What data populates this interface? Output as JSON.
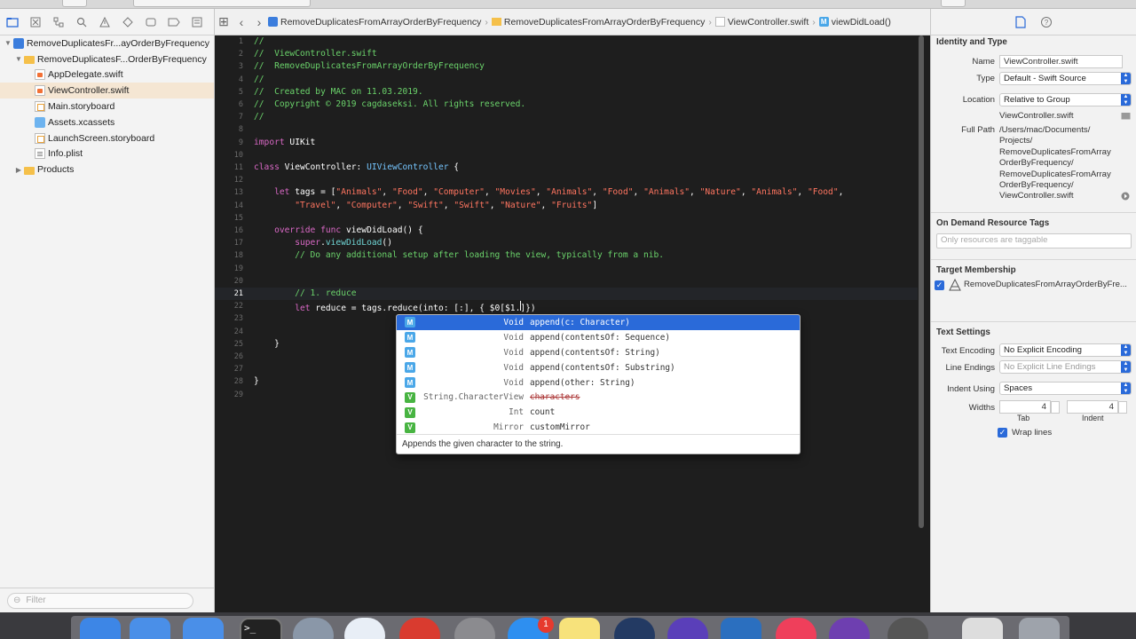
{
  "navigator": {
    "items": [
      {
        "label": "RemoveDuplicatesFr...ayOrderByFrequency",
        "kind": "project",
        "indent": 0,
        "disclosure": "▼"
      },
      {
        "label": "RemoveDuplicatesF...OrderByFrequency",
        "kind": "folder",
        "indent": 1,
        "disclosure": "▼"
      },
      {
        "label": "AppDelegate.swift",
        "kind": "swift",
        "indent": 2,
        "disclosure": ""
      },
      {
        "label": "ViewController.swift",
        "kind": "swift",
        "indent": 2,
        "disclosure": "",
        "selected": true
      },
      {
        "label": "Main.storyboard",
        "kind": "storyboard",
        "indent": 2,
        "disclosure": ""
      },
      {
        "label": "Assets.xcassets",
        "kind": "assets",
        "indent": 2,
        "disclosure": ""
      },
      {
        "label": "LaunchScreen.storyboard",
        "kind": "storyboard",
        "indent": 2,
        "disclosure": ""
      },
      {
        "label": "Info.plist",
        "kind": "plist",
        "indent": 2,
        "disclosure": ""
      },
      {
        "label": "Products",
        "kind": "folder",
        "indent": 1,
        "disclosure": "▶"
      }
    ],
    "filter_placeholder": "Filter"
  },
  "jumpbar": {
    "crumbs": [
      "RemoveDuplicatesFromArrayOrderByFrequency",
      "RemoveDuplicatesFromArrayOrderByFrequency",
      "ViewController.swift",
      "viewDidLoad()"
    ]
  },
  "editor": {
    "current_line": 21,
    "line_numbers": [
      "1",
      "2",
      "3",
      "4",
      "5",
      "6",
      "7",
      "8",
      "9",
      "10",
      "11",
      "12",
      "13",
      "14",
      "15",
      "16",
      "17",
      "18",
      "19",
      "20",
      "21",
      "22",
      "23",
      "24",
      "25",
      "26",
      "27",
      "28",
      "29"
    ],
    "lines": [
      [
        {
          "t": "//",
          "c": "com"
        }
      ],
      [
        {
          "t": "//  ViewController.swift",
          "c": "com"
        }
      ],
      [
        {
          "t": "//  RemoveDuplicatesFromArrayOrderByFrequency",
          "c": "com"
        }
      ],
      [
        {
          "t": "//",
          "c": "com"
        }
      ],
      [
        {
          "t": "//  Created by MAC on 11.03.2019.",
          "c": "com"
        }
      ],
      [
        {
          "t": "//  Copyright © 2019 cagdaseksi. All rights reserved.",
          "c": "com"
        }
      ],
      [
        {
          "t": "//",
          "c": "com"
        }
      ],
      [],
      [
        {
          "t": "import",
          "c": "kw"
        },
        {
          "t": " UIKit",
          "c": ""
        }
      ],
      [],
      [
        {
          "t": "class",
          "c": "kw"
        },
        {
          "t": " ViewController: ",
          "c": ""
        },
        {
          "t": "UIViewController",
          "c": "typ"
        },
        {
          "t": " {",
          "c": ""
        }
      ],
      [],
      [
        {
          "t": "    let",
          "c": "kw"
        },
        {
          "t": " tags = [",
          "c": ""
        },
        {
          "t": "\"Animals\"",
          "c": "str"
        },
        {
          "t": ", ",
          "c": ""
        },
        {
          "t": "\"Food\"",
          "c": "str"
        },
        {
          "t": ", ",
          "c": ""
        },
        {
          "t": "\"Computer\"",
          "c": "str"
        },
        {
          "t": ", ",
          "c": ""
        },
        {
          "t": "\"Movies\"",
          "c": "str"
        },
        {
          "t": ", ",
          "c": ""
        },
        {
          "t": "\"Animals\"",
          "c": "str"
        },
        {
          "t": ", ",
          "c": ""
        },
        {
          "t": "\"Food\"",
          "c": "str"
        },
        {
          "t": ", ",
          "c": ""
        },
        {
          "t": "\"Animals\"",
          "c": "str"
        },
        {
          "t": ", ",
          "c": ""
        },
        {
          "t": "\"Nature\"",
          "c": "str"
        },
        {
          "t": ", ",
          "c": ""
        },
        {
          "t": "\"Animals\"",
          "c": "str"
        },
        {
          "t": ", ",
          "c": ""
        },
        {
          "t": "\"Food\"",
          "c": "str"
        },
        {
          "t": ",",
          "c": ""
        }
      ],
      [
        {
          "t": "        \"Travel\"",
          "c": "str"
        },
        {
          "t": ", ",
          "c": ""
        },
        {
          "t": "\"Computer\"",
          "c": "str"
        },
        {
          "t": ", ",
          "c": ""
        },
        {
          "t": "\"Swift\"",
          "c": "str"
        },
        {
          "t": ", ",
          "c": ""
        },
        {
          "t": "\"Swift\"",
          "c": "str"
        },
        {
          "t": ", ",
          "c": ""
        },
        {
          "t": "\"Nature\"",
          "c": "str"
        },
        {
          "t": ", ",
          "c": ""
        },
        {
          "t": "\"Fruits\"",
          "c": "str"
        },
        {
          "t": "]",
          "c": ""
        }
      ],
      [],
      [
        {
          "t": "    override",
          "c": "kw"
        },
        {
          "t": " ",
          "c": ""
        },
        {
          "t": "func",
          "c": "kw"
        },
        {
          "t": " viewDidLoad() {",
          "c": ""
        }
      ],
      [
        {
          "t": "        super",
          "c": "kw"
        },
        {
          "t": ".",
          "c": ""
        },
        {
          "t": "viewDidLoad",
          "c": "fn"
        },
        {
          "t": "()",
          "c": ""
        }
      ],
      [
        {
          "t": "        // Do any additional setup after loading the view, typically from a nib.",
          "c": "com"
        }
      ],
      [],
      [],
      [
        {
          "t": "        // 1. reduce",
          "c": "com"
        }
      ],
      [
        {
          "t": "        let",
          "c": "kw"
        },
        {
          "t": " reduce = tags.reduce(into: [:], { $0[$1.",
          "c": ""
        },
        {
          "t": "|",
          "c": "cur"
        },
        {
          "t": "]})",
          "c": ""
        }
      ],
      [],
      [],
      [
        {
          "t": "    }",
          "c": ""
        }
      ],
      [],
      [],
      [
        {
          "t": "}",
          "c": ""
        }
      ],
      [],
      []
    ]
  },
  "autocomplete": {
    "items": [
      {
        "kind": "M",
        "ret": "Void",
        "name": "append(c: Character)",
        "selected": true
      },
      {
        "kind": "M",
        "ret": "Void",
        "name": "append(contentsOf: Sequence)"
      },
      {
        "kind": "M",
        "ret": "Void",
        "name": "append(contentsOf: String)"
      },
      {
        "kind": "M",
        "ret": "Void",
        "name": "append(contentsOf: Substring)"
      },
      {
        "kind": "M",
        "ret": "Void",
        "name": "append(other: String)"
      },
      {
        "kind": "V",
        "ret": "String.CharacterView",
        "name": "characters",
        "deprecated": true
      },
      {
        "kind": "V",
        "ret": "Int",
        "name": "count"
      },
      {
        "kind": "V",
        "ret": "Mirror",
        "name": "customMirror"
      }
    ],
    "description": "Appends the given character to the string."
  },
  "inspector": {
    "identity_title": "Identity and Type",
    "name_label": "Name",
    "name_value": "ViewController.swift",
    "type_label": "Type",
    "type_value": "Default - Swift Source",
    "location_label": "Location",
    "location_value": "Relative to Group",
    "location_file": "ViewController.swift",
    "fullpath_label": "Full Path",
    "fullpath_lines": [
      "/Users/mac/Documents/",
      "Projects/",
      "RemoveDuplicatesFromArray",
      "OrderByFrequency/",
      "RemoveDuplicatesFromArray",
      "OrderByFrequency/",
      "ViewController.swift"
    ],
    "odr_title": "On Demand Resource Tags",
    "odr_placeholder": "Only resources are taggable",
    "target_title": "Target Membership",
    "target_item": "RemoveDuplicatesFromArrayOrderByFre...",
    "text_title": "Text Settings",
    "encoding_label": "Text Encoding",
    "encoding_value": "No Explicit Encoding",
    "endings_label": "Line Endings",
    "endings_value": "No Explicit Line Endings",
    "indent_label": "Indent Using",
    "indent_value": "Spaces",
    "widths_label": "Widths",
    "tab_width": "4",
    "indent_width": "4",
    "tab_label": "Tab",
    "indent_small_label": "Indent",
    "wrap_label": "Wrap lines"
  },
  "dock": {
    "appstore_badge": "1"
  }
}
